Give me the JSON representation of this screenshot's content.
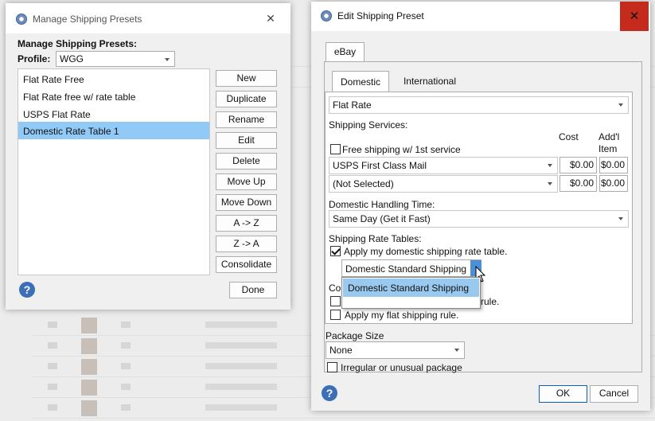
{
  "left_dialog": {
    "title": "Manage Shipping Presets",
    "heading": "Manage Shipping Presets:",
    "profile_label": "Profile:",
    "profile_value": "WGG",
    "presets": [
      "Flat Rate Free",
      "Flat Rate free w/ rate table",
      "USPS Flat Rate",
      "Domestic Rate Table 1"
    ],
    "selected_index": 3,
    "buttons": {
      "new": "New",
      "duplicate": "Duplicate",
      "rename": "Rename",
      "edit": "Edit",
      "delete": "Delete",
      "move_up": "Move Up",
      "move_down": "Move Down",
      "a_to_z": "A -> Z",
      "z_to_a": "Z -> A",
      "consolidate": "Consolidate"
    },
    "done": "Done",
    "close": "✕"
  },
  "right_dialog": {
    "title": "Edit Shipping Preset",
    "close": "✕",
    "outer_tab": "eBay",
    "tabs": [
      "Domestic",
      "International"
    ],
    "shipping_type": "Flat Rate",
    "shipping_services_label": "Shipping Services:",
    "cost_header": "Cost",
    "addl_header_1": "Add'l",
    "addl_header_2": "Item",
    "free_shipping_label": "Free shipping w/ 1st service",
    "service_1": "USPS First Class Mail",
    "service_1_cost": "$0.00",
    "service_1_addl": "$0.00",
    "service_2": "(Not Selected)",
    "service_2_cost": "$0.00",
    "service_2_addl": "$0.00",
    "handling_time_label": "Domestic Handling Time:",
    "handling_time_value": "Same Day (Get it Fast)",
    "rate_tables_label": "Shipping Rate Tables:",
    "apply_rate_table_label": "Apply my domestic shipping rate table.",
    "rate_table_value": "Domestic Standard Shipping",
    "dropdown_option": "Domestic Standard Shipping",
    "partial_label_prefix": "Co",
    "partial_rule_suffix": "rule.",
    "flat_rule_label": "Apply my flat shipping rule.",
    "package_size_label": "Package Size",
    "package_size_value": "None",
    "irregular_label": "Irregular or unusual package",
    "ok": "OK",
    "cancel": "Cancel"
  },
  "colors": {
    "selection": "#91c9f7",
    "dropdown_highlight": "#99c9ef",
    "close_red": "#c42b1c",
    "help_blue": "#3c6fb6"
  }
}
